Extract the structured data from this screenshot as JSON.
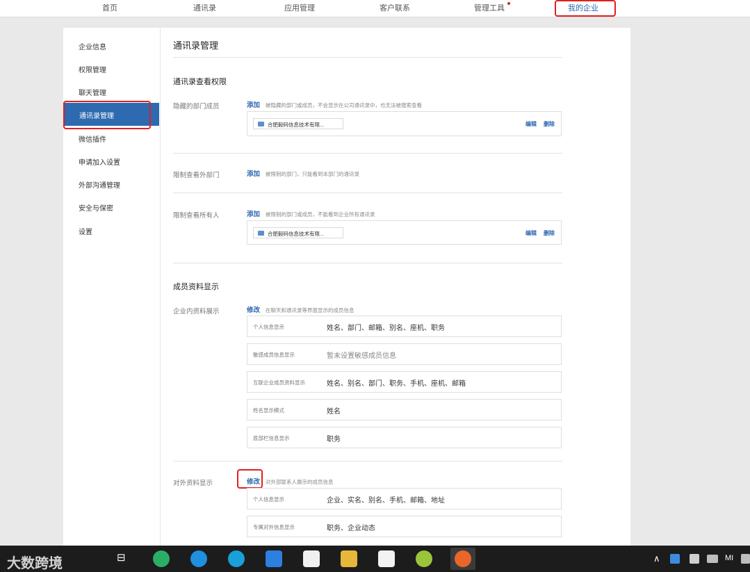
{
  "topnav": {
    "items": [
      "首页",
      "通讯录",
      "应用管理",
      "客户联系",
      "管理工具",
      "我的企业"
    ]
  },
  "sidebar": {
    "items": [
      "企业信息",
      "权限管理",
      "聊天管理",
      "通讯录管理",
      "微信插件",
      "申请加入设置",
      "外部沟通管理",
      "安全与保密",
      "设置"
    ],
    "active_index": 3
  },
  "main": {
    "title": "通讯录管理",
    "view_permissions": {
      "heading": "通讯录查看权限",
      "hidden_members": {
        "label": "隐藏的部门成员",
        "add_label": "添加",
        "hint": "被隐藏的部门或成员，不会显示在公司通讯录中，也无法被搜索查看",
        "chip": "合肥毅码信息技术有限...",
        "edit_label": "编辑",
        "delete_label": "删除"
      },
      "restrict_external_dept": {
        "label": "限制查看外部门",
        "add_label": "添加",
        "hint": "被限制的部门，只能看到本部门的通讯录"
      },
      "restrict_all": {
        "label": "限制查看所有人",
        "add_label": "添加",
        "hint": "被限制的部门或成员，不能看到企业所有通讯录",
        "chip": "合肥毅码信息技术有限...",
        "edit_label": "编辑",
        "delete_label": "删除"
      }
    },
    "member_display": {
      "heading": "成员资料显示",
      "internal": {
        "label": "企业内资料展示",
        "edit_label": "修改",
        "hint": "在聊天和通讯录等界面显示的成员信息",
        "rows": [
          {
            "key": "个人信息显示",
            "value": "姓名、部门、邮箱、别名、座机、职务"
          },
          {
            "key": "敏感成员信息显示",
            "value": "暂未设置敏感成员信息"
          },
          {
            "key": "互联企业成员资料显示",
            "value": "姓名、别名、部门、职务、手机、座机、邮箱"
          },
          {
            "key": "姓名显示模式",
            "value": "姓名"
          },
          {
            "key": "底部栏信息显示",
            "value": "职务"
          }
        ]
      },
      "external": {
        "label": "对外资料显示",
        "edit_label": "修改",
        "hint": "对外部联系人展示的成员信息",
        "rows": [
          {
            "key": "个人信息显示",
            "value": "企业、实名、别名、手机、邮箱、地址"
          },
          {
            "key": "专属对外信息显示",
            "value": "职务、企业动态"
          }
        ]
      }
    }
  },
  "taskbar": {
    "watermark": "大数跨境"
  },
  "colors": {
    "accent": "#2d6ab0",
    "highlight_red": "#e02020"
  }
}
